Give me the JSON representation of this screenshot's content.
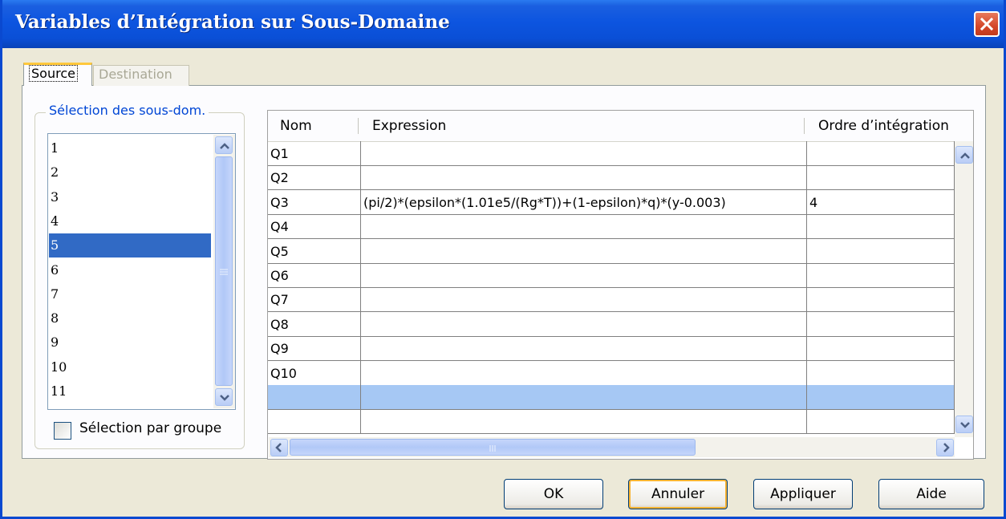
{
  "window": {
    "title": "Variables d’Intégration sur Sous-Domaine"
  },
  "tabs": [
    {
      "label": "Source",
      "active": true
    },
    {
      "label": "Destination",
      "active": false
    }
  ],
  "selection_group": {
    "title": "Sélection des sous-dom.",
    "items": [
      "1",
      "2",
      "3",
      "4",
      "5",
      "6",
      "7",
      "8",
      "9",
      "10",
      "11"
    ],
    "selected": "5",
    "group_checkbox": {
      "label": "Sélection par groupe",
      "checked": false
    }
  },
  "table": {
    "headers": [
      "Nom",
      "Expression",
      "Ordre d’intégration"
    ],
    "rows": [
      {
        "name": "Q1",
        "expression": "",
        "order": ""
      },
      {
        "name": "Q2",
        "expression": "",
        "order": ""
      },
      {
        "name": "Q3",
        "expression": "(pi/2)*(epsilon*(1.01e5/(Rg*T))+(1-epsilon)*q)*(y-0.003)",
        "order": "4"
      },
      {
        "name": "Q4",
        "expression": "",
        "order": ""
      },
      {
        "name": "Q5",
        "expression": "",
        "order": ""
      },
      {
        "name": "Q6",
        "expression": "",
        "order": ""
      },
      {
        "name": "Q7",
        "expression": "",
        "order": ""
      },
      {
        "name": "Q8",
        "expression": "",
        "order": ""
      },
      {
        "name": "Q9",
        "expression": "",
        "order": ""
      },
      {
        "name": "Q10",
        "expression": "",
        "order": ""
      },
      {
        "name": "",
        "expression": "",
        "order": ""
      },
      {
        "name": "",
        "expression": "",
        "order": ""
      }
    ],
    "selected_row_index": 10
  },
  "buttons": {
    "ok": "OK",
    "cancel": "Annuler",
    "apply": "Appliquer",
    "help": "Aide"
  },
  "colors": {
    "title_bar": "#0a4fd6",
    "selection": "#316ac5",
    "group_title": "#0046d5",
    "active_tab_accent": "#ffc83c"
  },
  "icons": {
    "close": "close-icon",
    "scroll_up": "chevron-up-icon",
    "scroll_down": "chevron-down-icon",
    "scroll_left": "chevron-left-icon",
    "scroll_right": "chevron-right-icon"
  }
}
